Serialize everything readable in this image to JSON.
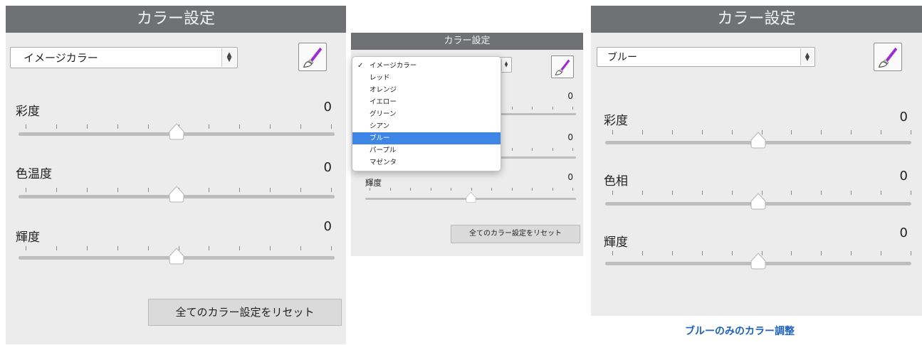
{
  "colors": {
    "header_bg": "#6f7175",
    "panel_bg": "#ececec",
    "highlight": "#3d86e6",
    "caption": "#2063b8",
    "brush": "#9b2fc9"
  },
  "icons": {
    "brush": "paintbrush-icon",
    "stepper": "up-down-stepper-icon",
    "check": "checkmark-icon"
  },
  "panel1": {
    "title": "カラー設定",
    "select_value": "イメージカラー",
    "sliders": [
      {
        "label": "彩度",
        "value": "0",
        "position": 0.5
      },
      {
        "label": "色温度",
        "value": "0",
        "position": 0.5
      },
      {
        "label": "輝度",
        "value": "0",
        "position": 0.5
      }
    ],
    "reset_label": "全てのカラー設定をリセット"
  },
  "panel2": {
    "title": "カラー設定",
    "sliders": [
      {
        "label": "",
        "value": "0",
        "position": 0.5
      },
      {
        "label": "",
        "value": "0",
        "position": 0.5
      },
      {
        "label": "輝度",
        "value": "0",
        "position": 0.5
      }
    ],
    "reset_label": "全てのカラー設定をリセット",
    "dropdown": {
      "items": [
        "イメージカラー",
        "レッド",
        "オレンジ",
        "イエロー",
        "グリーン",
        "シアン",
        "ブルー",
        "パープル",
        "マゼンタ"
      ],
      "checked_index": 0,
      "highlighted_index": 6
    }
  },
  "panel3": {
    "title": "カラー設定",
    "select_value": "ブルー",
    "sliders": [
      {
        "label": "彩度",
        "value": "0",
        "position": 0.5
      },
      {
        "label": "色相",
        "value": "0",
        "position": 0.5
      },
      {
        "label": "輝度",
        "value": "0",
        "position": 0.5
      }
    ],
    "caption": "ブルーのみのカラー調整"
  }
}
